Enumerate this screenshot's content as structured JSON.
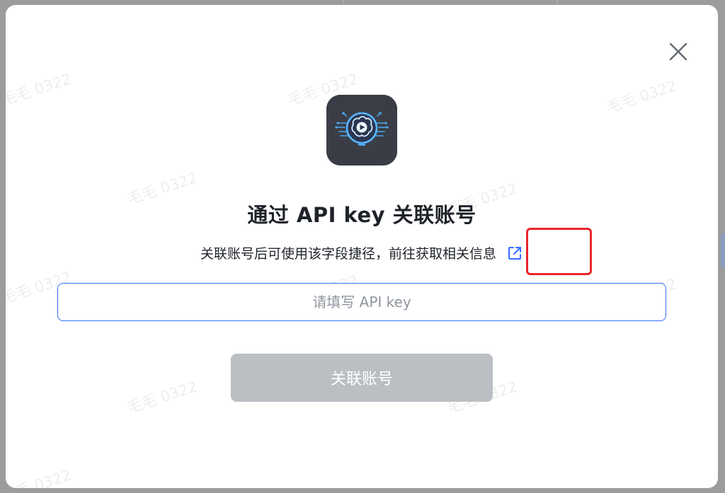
{
  "background": {
    "watermark_text": "毛毛 0322"
  },
  "dialog": {
    "close_icon": "close-icon",
    "logo_icon": "brain-video-app-logo",
    "title": "通过 API key 关联账号",
    "subtitle": "关联账号后可使用该字段捷径，前往获取相关信息",
    "external_link_icon": "external-link-icon",
    "input": {
      "value": "",
      "placeholder": "请填写 API key"
    },
    "submit_label": "关联账号",
    "colors": {
      "accent": "#3370ff",
      "highlight": "#e8262a",
      "button_disabled": "#bbbfc4"
    }
  }
}
